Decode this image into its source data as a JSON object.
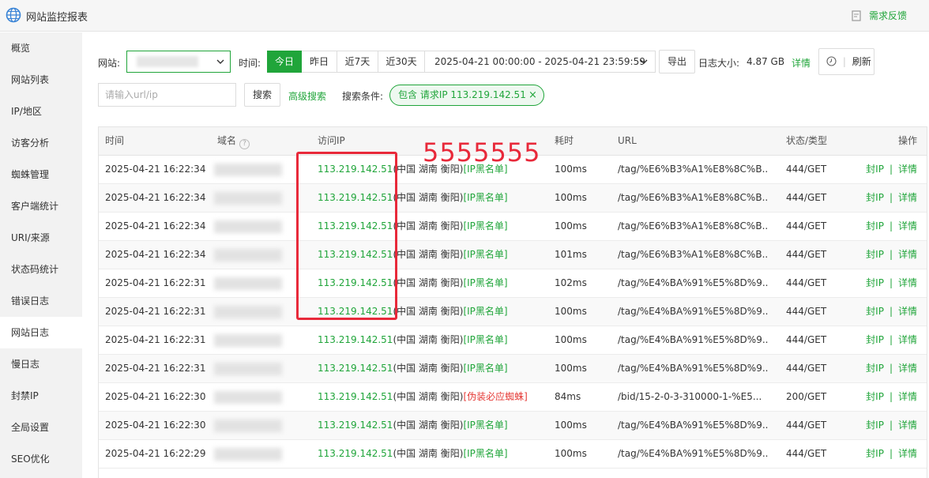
{
  "header": {
    "title": "网站监控报表",
    "feedback": "需求反馈"
  },
  "sidebar": {
    "items": [
      {
        "label": "概览"
      },
      {
        "label": "网站列表"
      },
      {
        "label": "IP/地区"
      },
      {
        "label": "访客分析"
      },
      {
        "label": "蜘蛛管理"
      },
      {
        "label": "客户端统计"
      },
      {
        "label": "URI/来源"
      },
      {
        "label": "状态码统计"
      },
      {
        "label": "错误日志"
      },
      {
        "label": "网站日志",
        "active": true
      },
      {
        "label": "慢日志"
      },
      {
        "label": "封禁IP"
      },
      {
        "label": "全局设置"
      },
      {
        "label": "SEO优化"
      }
    ]
  },
  "filters": {
    "site_label": "网站:",
    "time_label": "时间:",
    "time_tabs": [
      "今日",
      "昨日",
      "近7天",
      "近30天"
    ],
    "active_tab": "今日",
    "date_range": "2025-04-21 00:00:00 - 2025-04-21 23:59:59",
    "export": "导出",
    "log_size_label": "日志大小:",
    "log_size_value": "4.87 GB",
    "details": "详情",
    "refresh": "刷新",
    "search_placeholder": "请输入url/ip",
    "search_button": "搜索",
    "advanced_search": "高级搜索",
    "conditions_label": "搜索条件:",
    "condition_tag": "包含 请求IP 113.219.142.51",
    "tag_close": "×"
  },
  "table": {
    "headers": {
      "time": "时间",
      "domain": "域名",
      "ip": "访问IP",
      "cost": "耗时",
      "url": "URL",
      "status": "状态/类型",
      "ops": "操作"
    },
    "ops": {
      "ban": "封IP",
      "sep": "|",
      "detail": "详情"
    },
    "rows": [
      {
        "time": "2025-04-21 16:22:34",
        "ip": "113.219.142.51",
        "location": "(中国 湖南 衡阳)",
        "flag": "[IP黑名单]",
        "flag_color": "#20a53a",
        "cost": "100ms",
        "url": "/tag/%E6%B3%A1%E8%8C%B...",
        "status": "444/GET"
      },
      {
        "time": "2025-04-21 16:22:34",
        "ip": "113.219.142.51",
        "location": "(中国 湖南 衡阳)",
        "flag": "[IP黑名单]",
        "flag_color": "#20a53a",
        "cost": "100ms",
        "url": "/tag/%E6%B3%A1%E8%8C%B...",
        "status": "444/GET"
      },
      {
        "time": "2025-04-21 16:22:34",
        "ip": "113.219.142.51",
        "location": "(中国 湖南 衡阳)",
        "flag": "[IP黑名单]",
        "flag_color": "#20a53a",
        "cost": "100ms",
        "url": "/tag/%E6%B3%A1%E8%8C%B...",
        "status": "444/GET"
      },
      {
        "time": "2025-04-21 16:22:34",
        "ip": "113.219.142.51",
        "location": "(中国 湖南 衡阳)",
        "flag": "[IP黑名单]",
        "flag_color": "#20a53a",
        "cost": "101ms",
        "url": "/tag/%E6%B3%A1%E8%8C%B...",
        "status": "444/GET"
      },
      {
        "time": "2025-04-21 16:22:31",
        "ip": "113.219.142.51",
        "location": "(中国 湖南 衡阳)",
        "flag": "[IP黑名单]",
        "flag_color": "#20a53a",
        "cost": "102ms",
        "url": "/tag/%E4%BA%91%E5%8D%9...",
        "status": "444/GET"
      },
      {
        "time": "2025-04-21 16:22:31",
        "ip": "113.219.142.51",
        "location": "(中国 湖南 衡阳)",
        "flag": "[IP黑名单]",
        "flag_color": "#20a53a",
        "cost": "100ms",
        "url": "/tag/%E4%BA%91%E5%8D%9...",
        "status": "444/GET"
      },
      {
        "time": "2025-04-21 16:22:31",
        "ip": "113.219.142.51",
        "location": "(中国 湖南 衡阳)",
        "flag": "[IP黑名单]",
        "flag_color": "#20a53a",
        "cost": "100ms",
        "url": "/tag/%E4%BA%91%E5%8D%9...",
        "status": "444/GET"
      },
      {
        "time": "2025-04-21 16:22:31",
        "ip": "113.219.142.51",
        "location": "(中国 湖南 衡阳)",
        "flag": "[IP黑名单]",
        "flag_color": "#20a53a",
        "cost": "100ms",
        "url": "/tag/%E4%BA%91%E5%8D%9...",
        "status": "444/GET"
      },
      {
        "time": "2025-04-21 16:22:30",
        "ip": "113.219.142.51",
        "location": "(中国 湖南 衡阳)",
        "flag": "[伪装必应蜘蛛]",
        "flag_color": "#e53935",
        "cost": "84ms",
        "url": "/bid/15-2-0-3-310000-1-%E5...",
        "status": "200/GET"
      },
      {
        "time": "2025-04-21 16:22:30",
        "ip": "113.219.142.51",
        "location": "(中国 湖南 衡阳)",
        "flag": "[IP黑名单]",
        "flag_color": "#20a53a",
        "cost": "100ms",
        "url": "/tag/%E4%BA%91%E5%8D%9...",
        "status": "444/GET"
      },
      {
        "time": "2025-04-21 16:22:29",
        "ip": "113.219.142.51",
        "location": "(中国 湖南 衡阳)",
        "flag": "[IP黑名单]",
        "flag_color": "#20a53a",
        "cost": "100ms",
        "url": "/tag/%E4%BA%91%E5%8D%9...",
        "status": "444/GET"
      }
    ]
  },
  "annotation": {
    "text": "5555555",
    "color": "#e8293a"
  },
  "colors": {
    "accent": "#20a53a",
    "warning": "#e53935"
  }
}
